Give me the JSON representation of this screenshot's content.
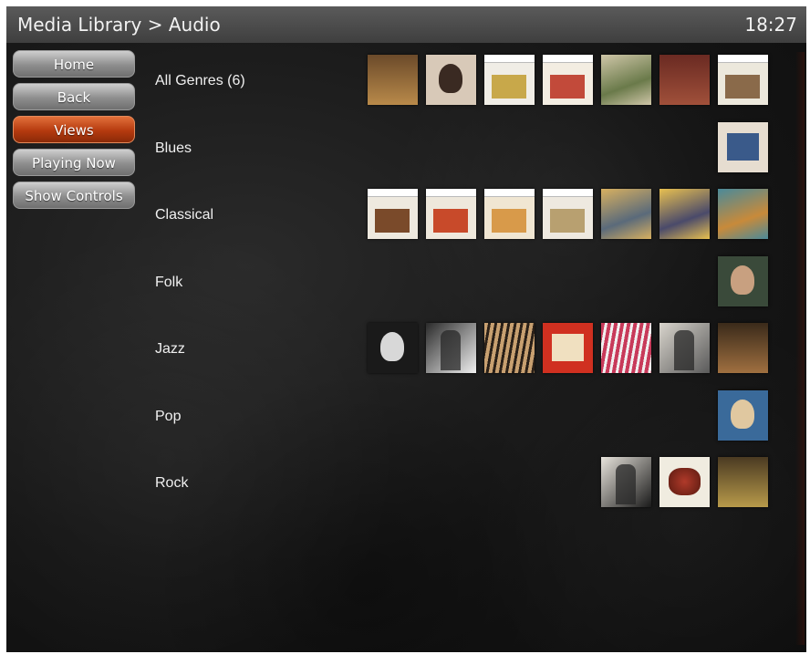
{
  "header": {
    "breadcrumb": "Media Library > Audio",
    "clock": "18:27"
  },
  "nav": {
    "buttons": [
      {
        "label": "Home",
        "active": false
      },
      {
        "label": "Back",
        "active": false
      },
      {
        "label": "Views",
        "active": true
      },
      {
        "label": "Playing Now",
        "active": false
      },
      {
        "label": "Show Controls",
        "active": false
      }
    ]
  },
  "colors": {
    "accent": "#b53a0f",
    "titlebar": "#4a4a4a",
    "background": "#161616"
  },
  "genres": [
    {
      "label": "All Genres (6)",
      "albums": [
        {
          "c1": "#6b4a2a",
          "c2": "#b98a4a",
          "style": "figures"
        },
        {
          "c1": "#d8c9b8",
          "c2": "#3a2a22",
          "style": "portrait"
        },
        {
          "c1": "#f0ede6",
          "c2": "#c8a84a",
          "style": "naxos"
        },
        {
          "c1": "#f3ede2",
          "c2": "#c24a3a",
          "style": "naxos"
        },
        {
          "c1": "#cfc6a8",
          "c2": "#6a7a4a",
          "style": "painting"
        },
        {
          "c1": "#6a2a22",
          "c2": "#a0503a",
          "style": "dark"
        },
        {
          "c1": "#ece8dc",
          "c2": "#8a6a4a",
          "style": "naxos"
        }
      ]
    },
    {
      "label": "Blues",
      "albums": [
        {
          "c1": "#e6ddd0",
          "c2": "#3a5a8a",
          "style": "poster"
        }
      ]
    },
    {
      "label": "Classical",
      "albums": [
        {
          "c1": "#eee9df",
          "c2": "#7a4a2a",
          "style": "naxos"
        },
        {
          "c1": "#eee8dc",
          "c2": "#c84a2a",
          "style": "naxos"
        },
        {
          "c1": "#f0e6d2",
          "c2": "#d89a4a",
          "style": "naxos"
        },
        {
          "c1": "#eee9e0",
          "c2": "#b8a070",
          "style": "naxos"
        },
        {
          "c1": "#d8b060",
          "c2": "#5a6a7a",
          "style": "painting"
        },
        {
          "c1": "#e8c050",
          "c2": "#4a4a6a",
          "style": "painting"
        },
        {
          "c1": "#4a8a9a",
          "c2": "#c88a3a",
          "style": "painting"
        }
      ]
    },
    {
      "label": "Folk",
      "albums": [
        {
          "c1": "#3a4a3a",
          "c2": "#c8a080",
          "style": "portrait"
        }
      ]
    },
    {
      "label": "Jazz",
      "albums": [
        {
          "c1": "#1a1a1a",
          "c2": "#d8d8d8",
          "style": "portrait"
        },
        {
          "c1": "#2a2a2a",
          "c2": "#f0f0f0",
          "style": "bw"
        },
        {
          "c1": "#c8a070",
          "c2": "#2a2018",
          "style": "keys"
        },
        {
          "c1": "#d03020",
          "c2": "#f0e0c0",
          "style": "poster"
        },
        {
          "c1": "#c83a5a",
          "c2": "#f0f0f0",
          "style": "keys"
        },
        {
          "c1": "#d8d4cc",
          "c2": "#5a5a5a",
          "style": "bw"
        },
        {
          "c1": "#3a2a1a",
          "c2": "#a07040",
          "style": "dark"
        }
      ]
    },
    {
      "label": "Pop",
      "albums": [
        {
          "c1": "#3a6a9a",
          "c2": "#e0c8a0",
          "style": "portrait"
        }
      ]
    },
    {
      "label": "Rock",
      "albums": [
        {
          "c1": "#e8e4dc",
          "c2": "#1a1a1a",
          "style": "bw"
        },
        {
          "c1": "#f0ece0",
          "c2": "#b03a2a",
          "style": "cake"
        },
        {
          "c1": "#4a3a22",
          "c2": "#b89a4a",
          "style": "dark"
        }
      ]
    }
  ]
}
